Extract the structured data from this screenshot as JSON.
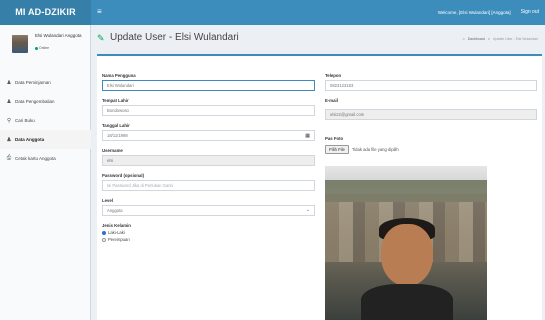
{
  "topbar": {
    "brand": "MI AD-DZIKIR",
    "menu_icon": "hamburger-icon",
    "welcome": "Welcome, [Elsi Wulandari] [Anggota]",
    "signout": "Sign out",
    "color": "#3c8dbc",
    "brand_color": "#367fa9"
  },
  "sidebar": {
    "user_name": "Elsi Wulandari Anggota",
    "user_status": "Online",
    "items": [
      {
        "label": "Data Peminjaman",
        "icon": "user-icon"
      },
      {
        "label": "Data Pengembalian",
        "icon": "user-icon"
      },
      {
        "label": "Cari Buku",
        "icon": "search-icon"
      },
      {
        "label": "Data Anggota",
        "icon": "user-icon",
        "active": true
      },
      {
        "label": "Cetak kartu Anggota",
        "icon": "print-icon"
      }
    ]
  },
  "header": {
    "title": "Update User - Elsi Wulandari",
    "breadcrumb": [
      "Dashboard",
      "Update User - Elsi Wulandari"
    ]
  },
  "form": {
    "nama_label": "Nama Pengguna",
    "nama_value": "Elsi Wulandari",
    "tempat_label": "Tempat Lahir",
    "tempat_value": "Bondowoso",
    "tanggal_label": "Tanggal Lahir",
    "tanggal_value": "18/11/1998",
    "username_label": "Username",
    "username_value": "elsi",
    "password_label": "Password (opsional)",
    "password_placeholder": "Isi Password Jika di Perlukan Ganti",
    "level_label": "Level",
    "level_value": "Anggota",
    "jk_label": "Jenis Kelamin",
    "jk_options": [
      "Laki-Laki",
      "Perempuan"
    ],
    "jk_selected": "Laki-Laki",
    "telepon_label": "Telepon",
    "telepon_value": "0823123183",
    "email_label": "E-mail",
    "email_value": "elsi22@gmail.com",
    "foto_label": "Pas Foto",
    "file_button": "Pilih File",
    "file_status": "Tidak ada file yang dipilih"
  },
  "colors": {
    "accent": "#3c8dbc",
    "success": "#00a65a",
    "radio_checked": "#2a6fd6"
  }
}
